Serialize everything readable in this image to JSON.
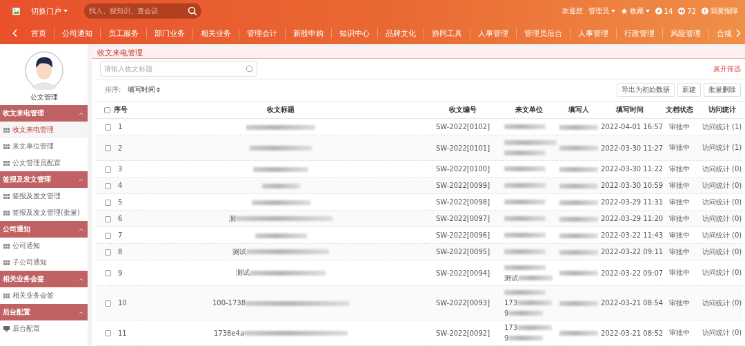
{
  "header": {
    "portal_label": "切换门户",
    "portal_menu_open": false,
    "search_placeholder": "找人、搜知识、查会议",
    "welcome": "欢迎您",
    "user": "管理员",
    "favorites": "收藏",
    "edit_count": "14",
    "view_count": "72",
    "report": "我要报障"
  },
  "nav": {
    "items": [
      "首页",
      "公司通知",
      "员工服务",
      "部门业务",
      "相关业务",
      "管理会计",
      "新股申购",
      "知识中心",
      "品牌文化",
      "协同工具",
      "人事管理",
      "管理员后台",
      "人事管理",
      "行政管理",
      "风险管理",
      "合规"
    ]
  },
  "sidebar": {
    "profile_name": "公文管理",
    "groups": [
      {
        "title": "收文来电管理",
        "expanded": true,
        "items": [
          {
            "label": "收文来电管理",
            "kind": "grid",
            "selected": true
          },
          {
            "label": "来文单位管理",
            "kind": "grid",
            "selected": false
          },
          {
            "label": "公文管理员配置",
            "kind": "grid",
            "selected": false
          }
        ]
      },
      {
        "title": "签报及发文管理",
        "expanded": true,
        "items": [
          {
            "label": "签报及发文管理",
            "kind": "grid",
            "selected": false
          },
          {
            "label": "签报及发文管理(批量)",
            "kind": "grid",
            "selected": false
          }
        ]
      },
      {
        "title": "公司通知",
        "expanded": true,
        "items": [
          {
            "label": "公司通知",
            "kind": "grid",
            "selected": false
          },
          {
            "label": "子公司通知",
            "kind": "grid",
            "selected": false
          }
        ]
      },
      {
        "title": "相关业务会签",
        "expanded": true,
        "items": [
          {
            "label": "相关业务会签",
            "kind": "grid",
            "selected": false
          }
        ]
      },
      {
        "title": "后台配置",
        "expanded": true,
        "items": [
          {
            "label": "后台配置",
            "kind": "monitor",
            "selected": false
          }
        ]
      }
    ]
  },
  "content": {
    "title": "收文来电管理",
    "search_placeholder": "请输入收文标题",
    "filter_toggle": "展开筛选",
    "sort_label": "排序:",
    "sort_field": "填写时间",
    "buttons": [
      "导出为初始数据",
      "新建",
      "批量删除"
    ],
    "table": {
      "all_checked": false,
      "columns": [
        "序号",
        "收文标题",
        "收文编号",
        "来文单位",
        "填写人",
        "填写时间",
        "文档状态",
        "访问统计"
      ],
      "rows": [
        {
          "no": "1",
          "checked": false,
          "number": "SW-2022[0102]",
          "time": "2022-04-01 16:57",
          "status": "审批中",
          "visits": "访问统计 (1)"
        },
        {
          "no": "2",
          "checked": false,
          "number": "SW-2022[0101]",
          "time": "2022-03-30 11:27",
          "status": "审批中",
          "visits": "访问统计 (1)"
        },
        {
          "no": "3",
          "checked": false,
          "number": "SW-2022[0100]",
          "time": "2022-03-30 11:22",
          "status": "审批中",
          "visits": "访问统计 (0)"
        },
        {
          "no": "4",
          "checked": false,
          "number": "SW-2022[0099]",
          "time": "2022-03-30 10:59",
          "status": "审批中",
          "visits": "访问统计 (0)"
        },
        {
          "no": "5",
          "checked": false,
          "number": "SW-2022[0098]",
          "time": "2022-03-29 11:31",
          "status": "审批中",
          "visits": "访问统计 (0)"
        },
        {
          "no": "6",
          "checked": false,
          "title_prefix": "测",
          "number": "SW-2022[0097]",
          "time": "2022-03-29 11:20",
          "status": "审批中",
          "visits": "访问统计 (0)"
        },
        {
          "no": "7",
          "checked": false,
          "number": "SW-2022[0096]",
          "time": "2022-03-22 11:43",
          "status": "审批中",
          "visits": "访问统计 (0)"
        },
        {
          "no": "8",
          "checked": false,
          "title_prefix": "测试",
          "number": "SW-2022[0095]",
          "time": "2022-03-22 09:11",
          "status": "审批中",
          "visits": "访问统计 (0)"
        },
        {
          "no": "9",
          "checked": false,
          "title_prefix": "测试",
          "unit_fragments": [
            "测试"
          ],
          "number": "SW-2022[0094]",
          "time": "2022-03-22 09:07",
          "status": "审批中",
          "visits": "访问统计 (0)"
        },
        {
          "no": "10",
          "checked": false,
          "title_prefix": "100-1738",
          "unit_fragments": [
            "173",
            "9"
          ],
          "number": "SW-2022[0093]",
          "time": "2022-03-21 08:54",
          "status": "审批中",
          "visits": "访问统计 (0)"
        },
        {
          "no": "11",
          "checked": false,
          "title_prefix": "1738e4a",
          "unit_fragments": [
            "173",
            "9"
          ],
          "number": "SW-2022[0092]",
          "time": "2022-03-21 08:52",
          "status": "审批中",
          "visits": "访问统计 (0)"
        }
      ]
    }
  }
}
